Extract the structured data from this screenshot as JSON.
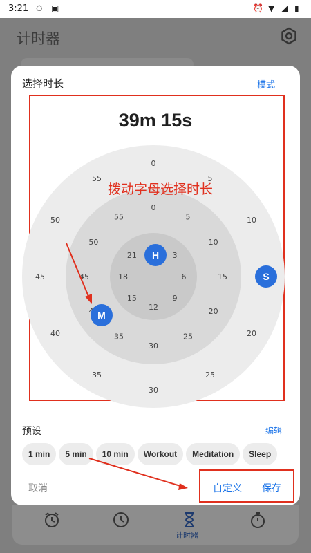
{
  "status": {
    "time": "3:21"
  },
  "app": {
    "title": "计时器"
  },
  "dialog": {
    "title": "选择时长",
    "mode_link": "模式",
    "duration_display": "39m 15s",
    "annotation": "拨动字母选择时长",
    "dial": {
      "outer_labels": [
        "0",
        "5",
        "10",
        "15",
        "20",
        "25",
        "30",
        "35",
        "40",
        "45",
        "50",
        "55"
      ],
      "middle_labels": [
        "0",
        "5",
        "10",
        "15",
        "20",
        "25",
        "30",
        "35",
        "40",
        "45",
        "50",
        "55"
      ],
      "inner_labels": [
        "12",
        "3",
        "6",
        "9",
        "15",
        "18",
        "21"
      ],
      "hour_handle": "H",
      "minute_handle": "M",
      "second_handle": "S",
      "selected": {
        "hours": 0,
        "minutes": 39,
        "seconds": 15
      }
    },
    "presets": {
      "title": "预设",
      "edit_link": "编辑",
      "chips": [
        "1 min",
        "5 min",
        "10 min",
        "Workout",
        "Meditation",
        "Sleep"
      ]
    },
    "buttons": {
      "cancel": "取消",
      "custom": "自定义",
      "save": "保存"
    }
  },
  "nav": {
    "active_label": "计时器"
  },
  "colors": {
    "accent": "#1a73e8",
    "annotation_red": "#e0301e",
    "dial_outer": "#ececec",
    "dial_middle": "#d9d9d9",
    "dial_inner": "#c9c9c9"
  }
}
